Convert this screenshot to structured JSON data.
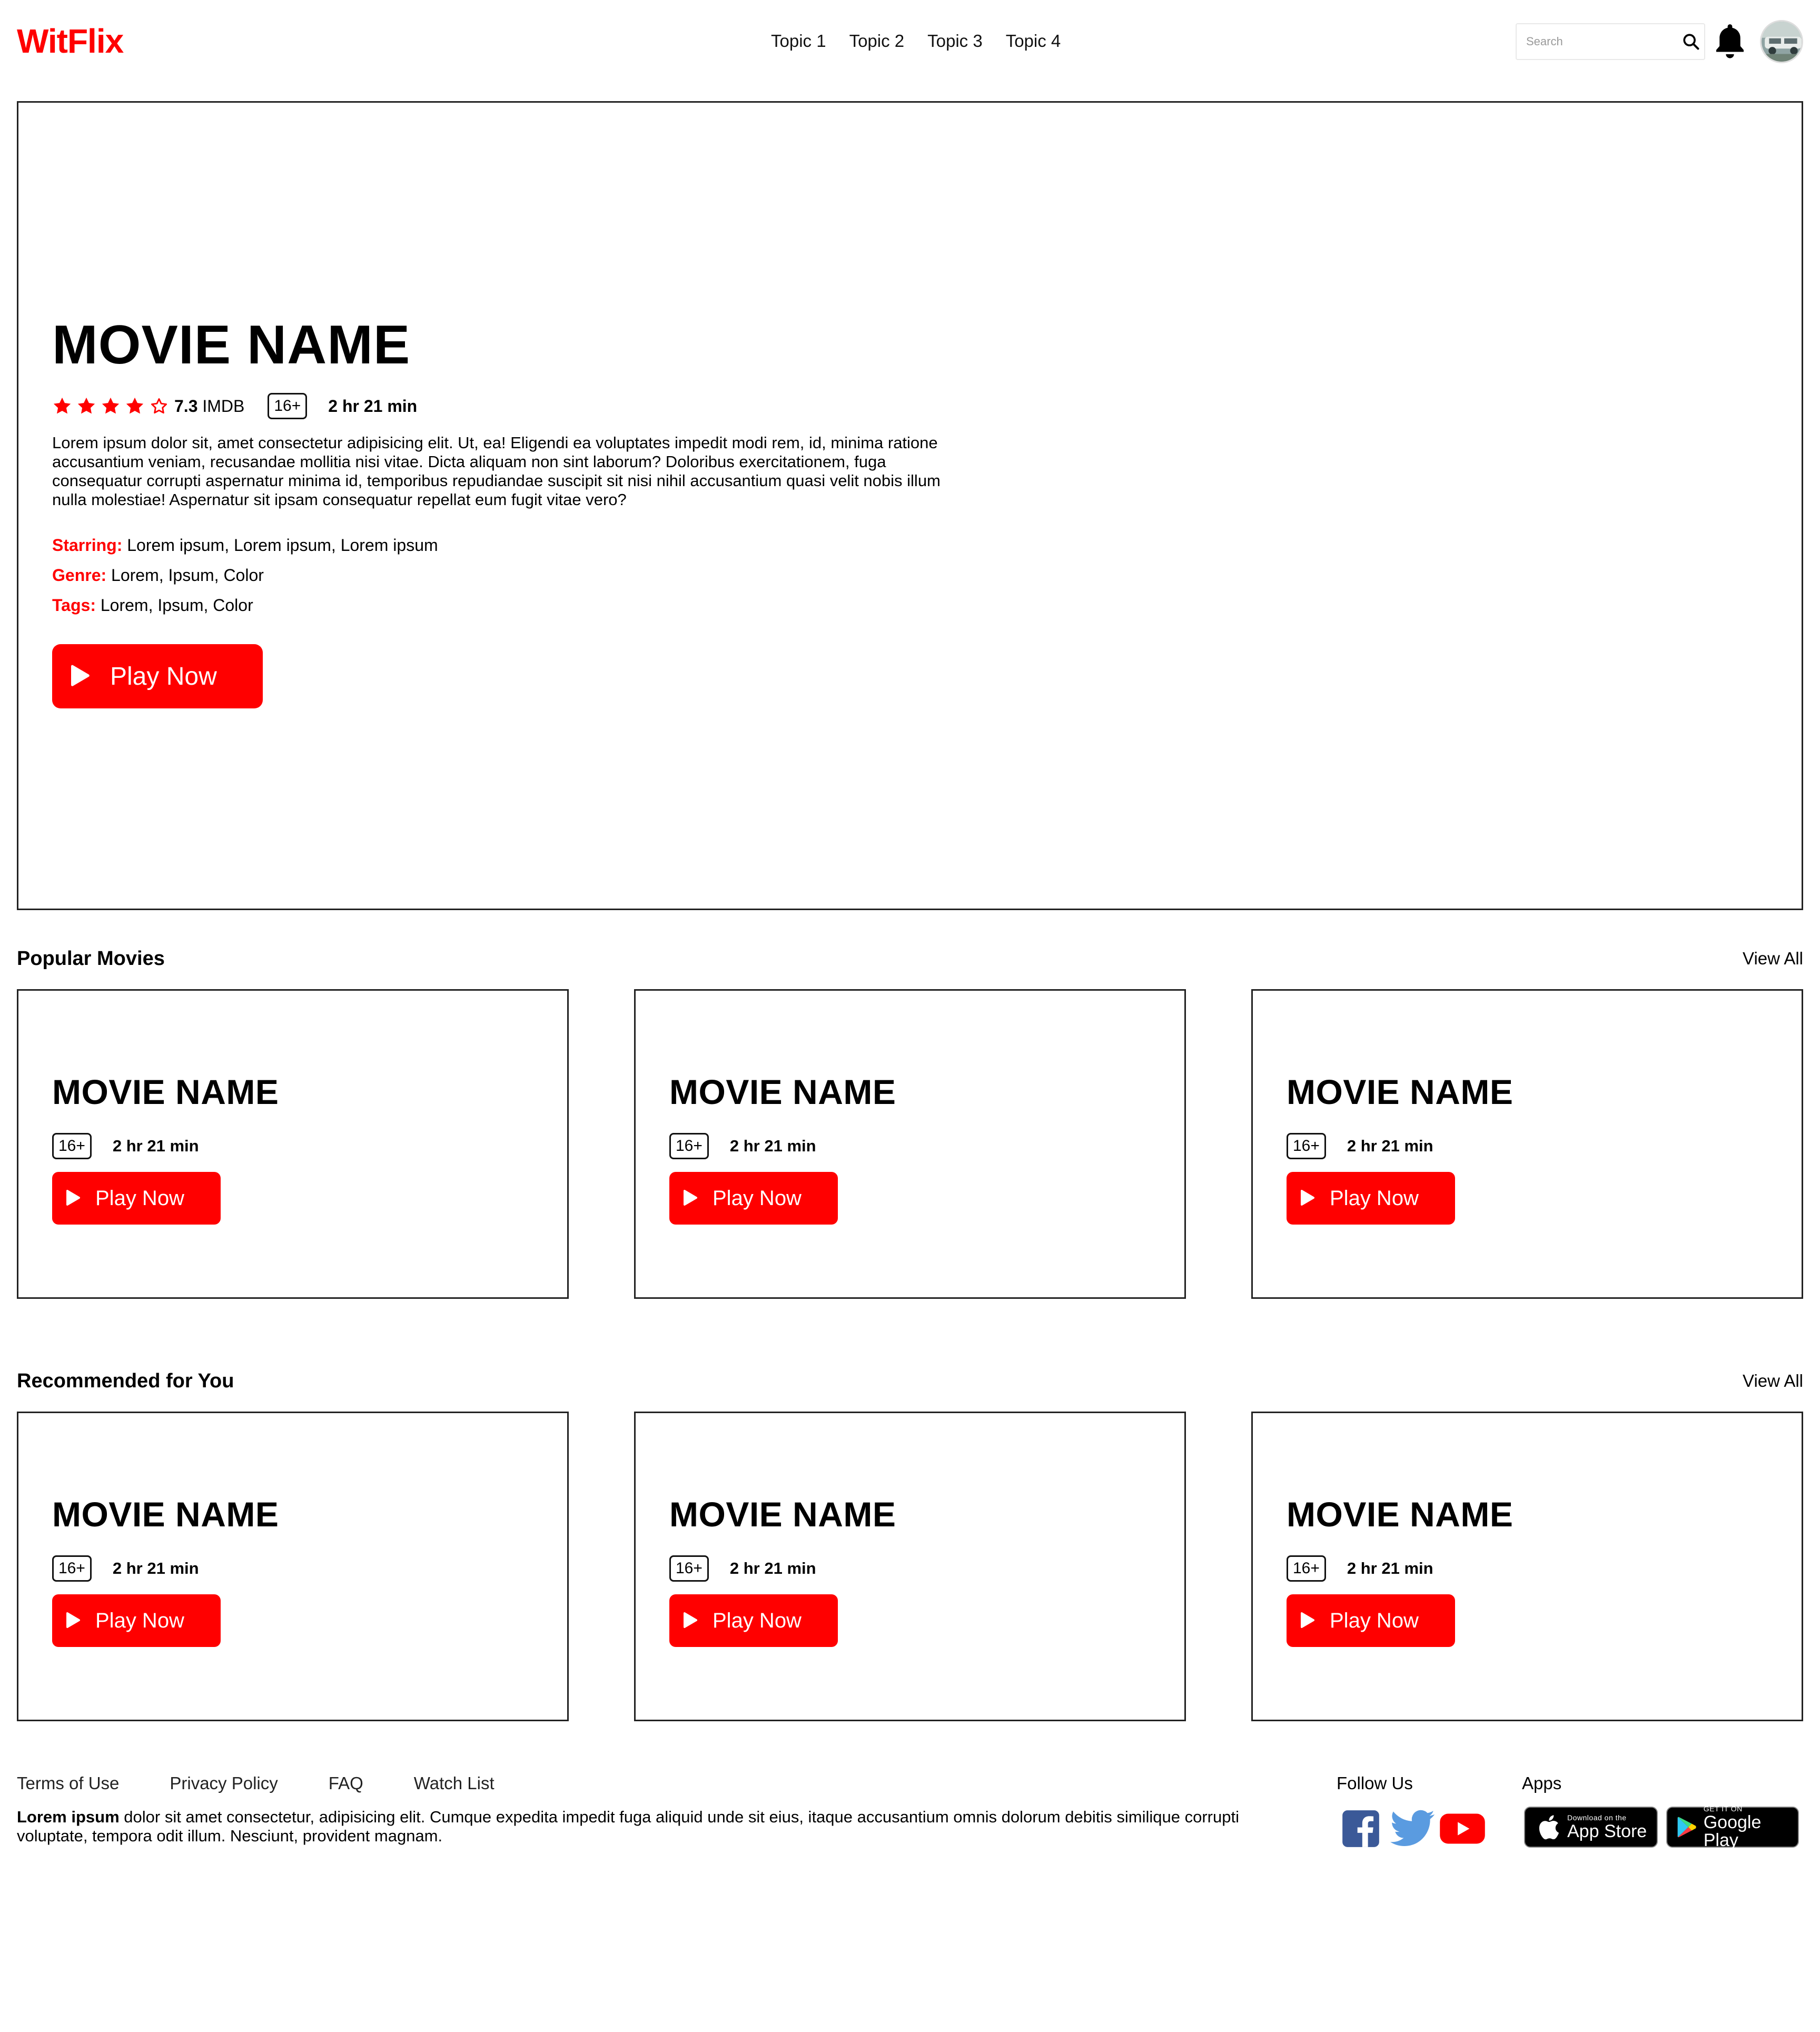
{
  "header": {
    "logo": "WitFlix",
    "nav": [
      "Topic 1",
      "Topic 2",
      "Topic 3",
      "Topic 4"
    ],
    "search_placeholder": "Search",
    "icons": {
      "search": "search-icon",
      "bell": "bell-icon",
      "avatar": "user-avatar"
    }
  },
  "hero": {
    "title": "MOVIE NAME",
    "rating_stars": 4,
    "rating_max": 5,
    "imdb_score": "7.3",
    "imdb_label": "IMDB",
    "age": "16+",
    "duration": "2 hr 21 min",
    "description": "Lorem ipsum dolor sit, amet consectetur adipisicing elit. Ut, ea! Eligendi ea voluptates impedit modi rem, id, minima ratione accusantium veniam, recusandae mollitia nisi vitae. Dicta aliquam non sint laborum? Doloribus exercitationem, fuga consequatur corrupti aspernatur minima id, temporibus repudiandae suscipit sit nisi nihil accusantium quasi velit nobis illum nulla molestiae! Aspernatur sit ipsam consequatur repellat eum fugit vitae vero?",
    "starring_label": "Starring:",
    "starring": "Lorem ipsum, Lorem ipsum, Lorem ipsum",
    "genre_label": "Genre:",
    "genre": "Lorem, Ipsum, Color",
    "tags_label": "Tags:",
    "tags": "Lorem, Ipsum, Color",
    "play_label": "Play Now"
  },
  "popular": {
    "title": "Popular Movies",
    "view_all": "View All",
    "cards": [
      {
        "title": "MOVIE NAME",
        "age": "16+",
        "duration": "2 hr 21 min",
        "play": "Play Now"
      },
      {
        "title": "MOVIE NAME",
        "age": "16+",
        "duration": "2 hr 21 min",
        "play": "Play Now"
      },
      {
        "title": "MOVIE NAME",
        "age": "16+",
        "duration": "2 hr 21 min",
        "play": "Play Now"
      }
    ]
  },
  "recommended": {
    "title": "Recommended for You",
    "view_all": "View All",
    "cards": [
      {
        "title": "MOVIE NAME",
        "age": "16+",
        "duration": "2 hr 21 min",
        "play": "Play Now"
      },
      {
        "title": "MOVIE NAME",
        "age": "16+",
        "duration": "2 hr 21 min",
        "play": "Play Now"
      },
      {
        "title": "MOVIE NAME",
        "age": "16+",
        "duration": "2 hr 21 min",
        "play": "Play Now"
      }
    ]
  },
  "footer": {
    "links": [
      "Terms of Use",
      "Privacy Policy",
      "FAQ",
      "Watch List"
    ],
    "text_bold": "Lorem ipsum",
    "text": " dolor sit amet consectetur, adipisicing elit. Cumque expedita impedit fuga aliquid unde sit eius, itaque accusantium omnis dolorum debitis similique corrupti voluptate, tempora odit illum. Nesciunt, provident magnam.",
    "follow_title": "Follow Us",
    "social": [
      "facebook-icon",
      "twitter-icon",
      "youtube-icon"
    ],
    "apps_title": "Apps",
    "app_store": {
      "small": "Download on the",
      "big": "App Store"
    },
    "google_play": {
      "small": "GET IT ON",
      "big": "Google Play"
    }
  },
  "colors": {
    "accent": "#ff0000",
    "border": "#222222",
    "text": "#000000"
  }
}
